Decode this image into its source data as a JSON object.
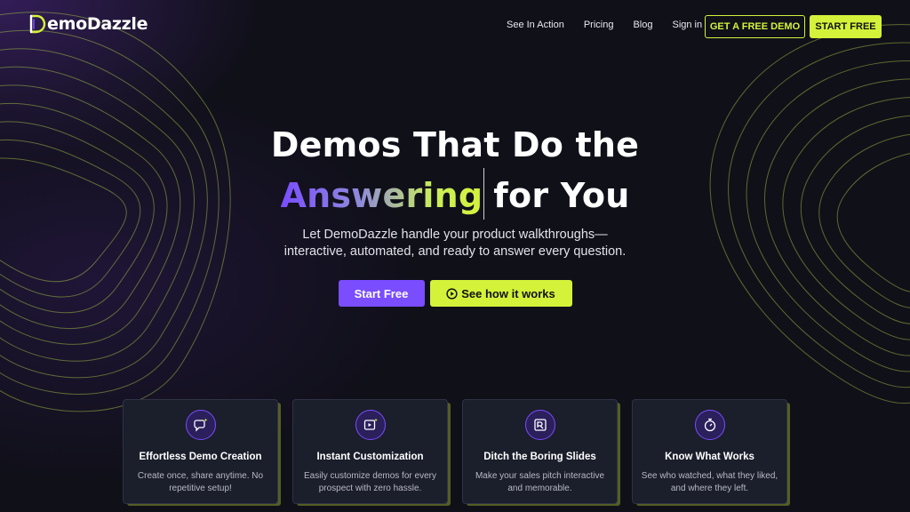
{
  "brand": {
    "logo_demo": "emo",
    "logo_dazzle": "Dazzle",
    "accent": "#d4f23a",
    "purple": "#7a4dff"
  },
  "nav": {
    "links": [
      "See In Action",
      "Pricing",
      "Blog",
      "Sign in"
    ],
    "demo_button": "GET A FREE DEMO",
    "start_button": "START FREE"
  },
  "hero": {
    "line1": "Demos That Do the",
    "highlight": "Answering",
    "line2_rest": "for You",
    "subtitle_1": "Let DemoDazzle handle your product walkthroughs—",
    "subtitle_2": "interactive, automated, and ready to answer every question.",
    "primary_cta": "Start Free",
    "secondary_cta": "See how it works"
  },
  "features": [
    {
      "icon": "sparkle-chat-icon",
      "title": "Effortless Demo Creation",
      "desc": "Create once, share anytime. No repetitive setup!"
    },
    {
      "icon": "video-sparkle-icon",
      "title": "Instant Customization",
      "desc": "Easily customize demos for every prospect with zero hassle."
    },
    {
      "icon": "slides-icon",
      "title": "Ditch the Boring Slides",
      "desc": "Make your sales pitch interactive and memorable."
    },
    {
      "icon": "stopwatch-icon",
      "title": "Know What Works",
      "desc": "See who watched, what they liked, and where they left."
    }
  ]
}
